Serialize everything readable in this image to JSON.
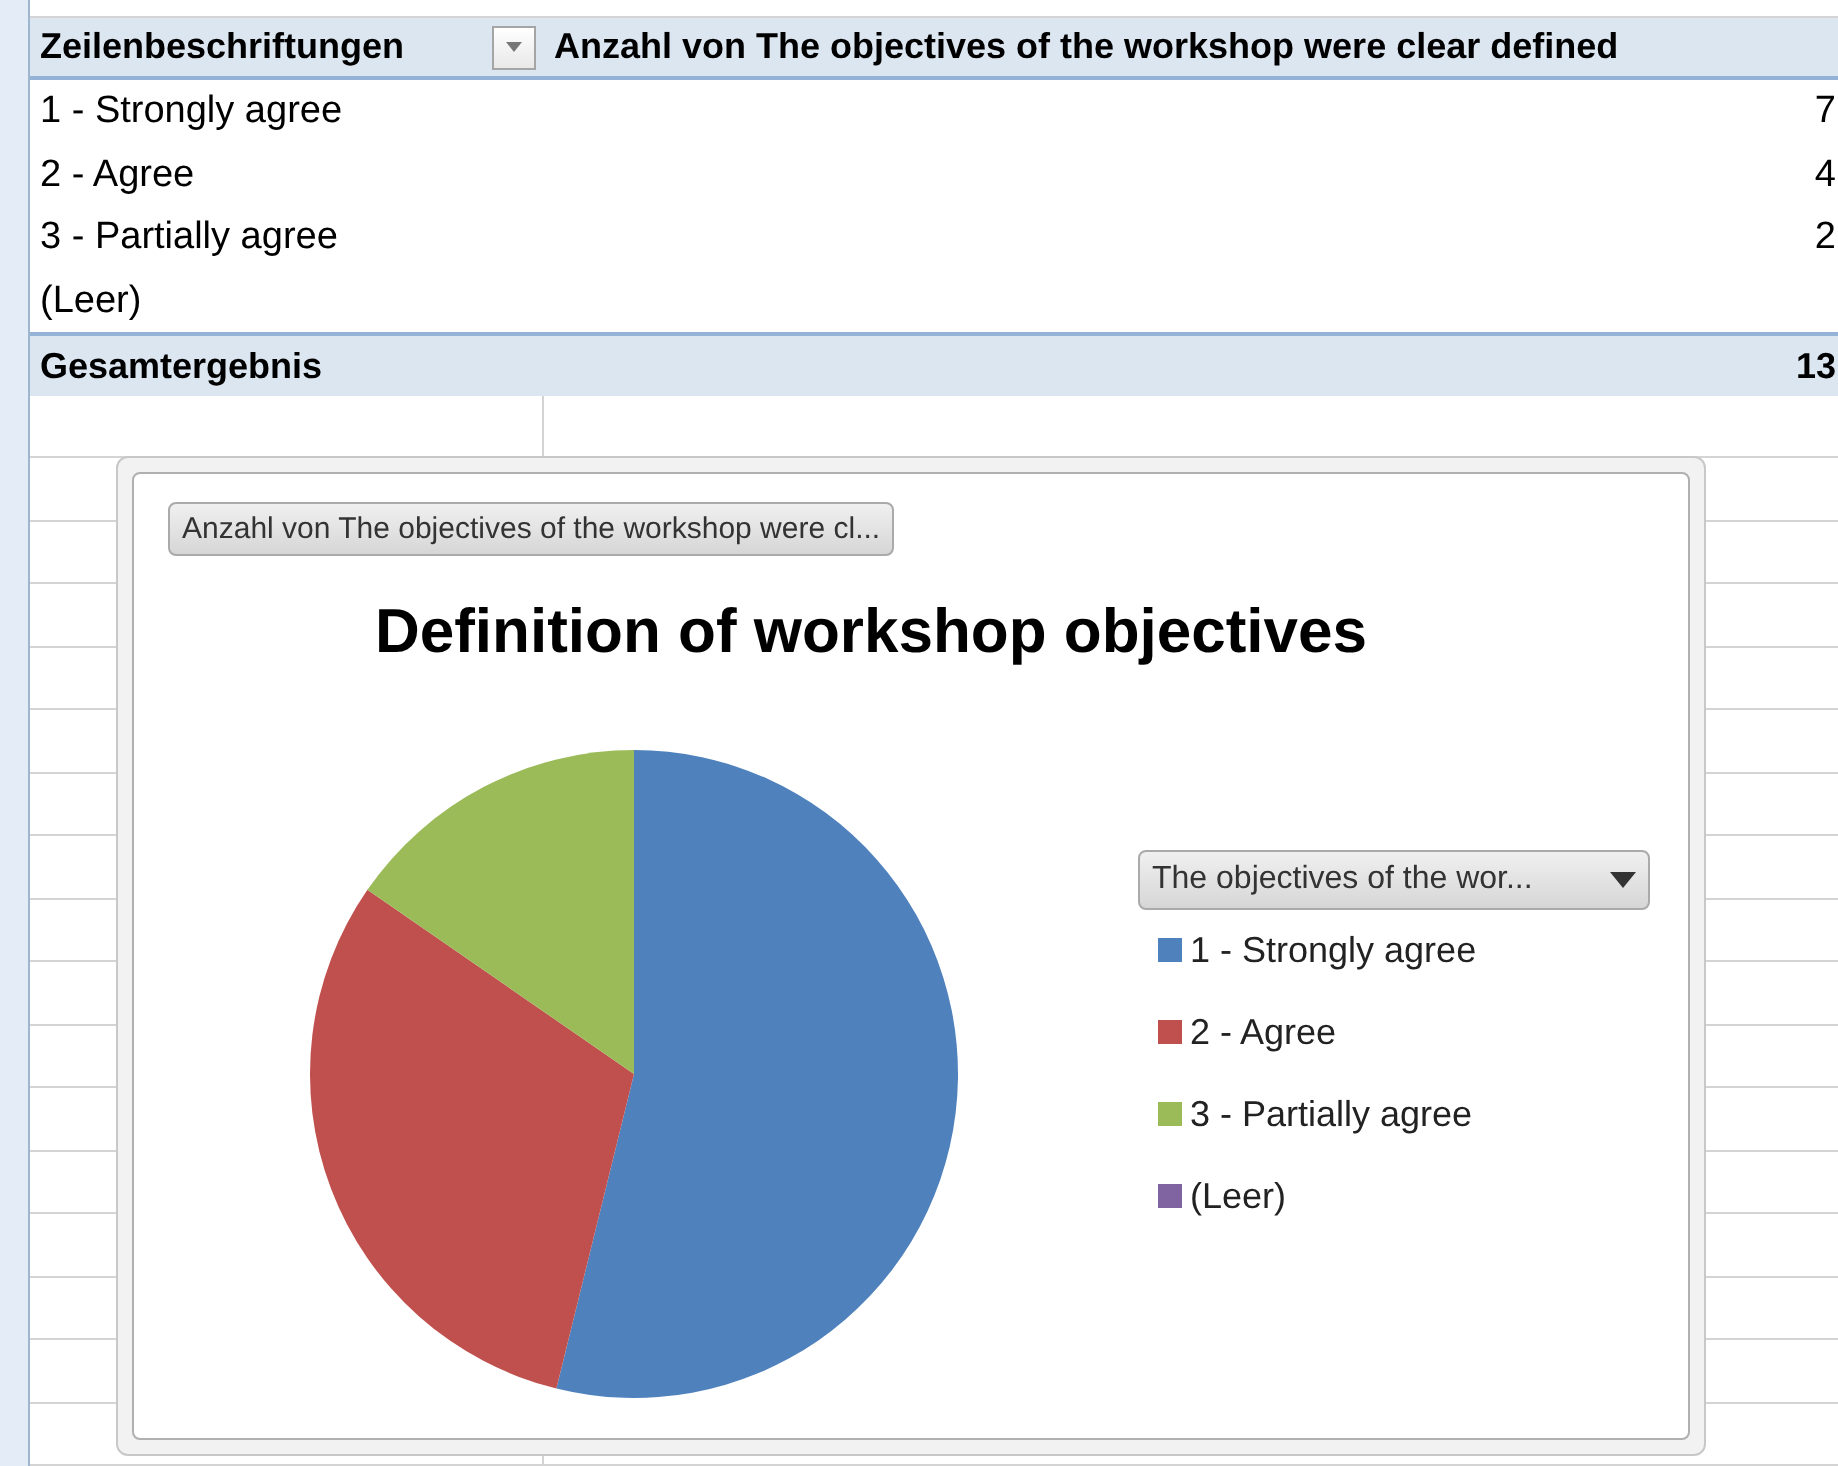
{
  "pivot_table": {
    "columns": [
      {
        "label": "Zeilenbeschriftungen",
        "filter": true
      },
      {
        "label": "Anzahl von The objectives of the workshop were clear defined"
      }
    ],
    "rows": [
      {
        "label": "1 - Strongly agree",
        "value": "7"
      },
      {
        "label": "2 - Agree",
        "value": "4"
      },
      {
        "label": "3 - Partially agree",
        "value": "2"
      },
      {
        "label": "(Leer)",
        "value": ""
      }
    ],
    "total": {
      "label": "Gesamtergebnis",
      "value": "13"
    }
  },
  "chart": {
    "field_button": "Anzahl von The objectives of the workshop were cl...",
    "legend_button": "The objectives of the wor...",
    "legend": [
      {
        "color": "#4f81bd"
      },
      {
        "color": "#c0504d"
      },
      {
        "color": "#9bbb59"
      },
      {
        "color": "#8064a2"
      }
    ],
    "chart_data": {
      "type": "pie",
      "title": "Definition of workshop objectives",
      "categories": [
        "1 - Strongly agree",
        "2 - Agree",
        "3 - Partially agree",
        "(Leer)"
      ],
      "legend": true,
      "series": [
        {
          "values": [
            53.85,
            30.77,
            15.38,
            0
          ]
        }
      ]
    }
  }
}
